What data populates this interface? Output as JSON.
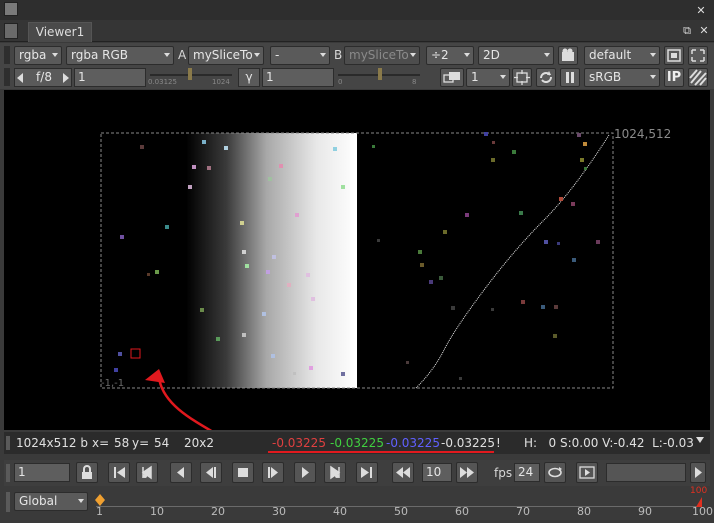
{
  "window": {
    "tab_label": "Viewer1"
  },
  "toolbar": {
    "channels": "rgba",
    "layer": "rgba",
    "layer_channels": "RGB",
    "input_a_label": "A",
    "input_a": "mySliceTo",
    "compare_mode": "-",
    "input_b_label": "B",
    "input_b": "mySliceTo",
    "downscale": "÷2",
    "view_mode": "2D",
    "lut": "default",
    "fstop": "f/8",
    "gain_value": "1",
    "gain_slider_left": "0.03125",
    "gain_slider_right": "1024",
    "gamma_label": "γ",
    "gamma_value": "1",
    "gamma_slider_left": "0",
    "gamma_slider_right": "8",
    "proxy_value": "1",
    "colorspace": "sRGB",
    "ip_label": "IP"
  },
  "viewer": {
    "format_corner_tr": "1024,512",
    "format_corner_bl": "-1,-1"
  },
  "info": {
    "format": "1024x512 b",
    "x_label": "x=",
    "x_value": "58",
    "y_label": "y=",
    "y_value": "54",
    "zoom": "20x2",
    "r": "-0.03225",
    "g": "-0.03225",
    "b": "-0.03225",
    "a": "-0.03225",
    "marker": "!",
    "hsv": "H:   0 S:0.00 V:-0.42  L:-0.03"
  },
  "playback": {
    "frame": "1",
    "increment": "10",
    "fps_label": "fps",
    "fps_value": "24"
  },
  "timeline": {
    "scope": "Global",
    "ticks": [
      "1",
      "10",
      "20",
      "30",
      "40",
      "50",
      "60",
      "70",
      "80",
      "90",
      "100"
    ],
    "end_marker": "100"
  },
  "annotation": {
    "color": "#e0191e"
  }
}
